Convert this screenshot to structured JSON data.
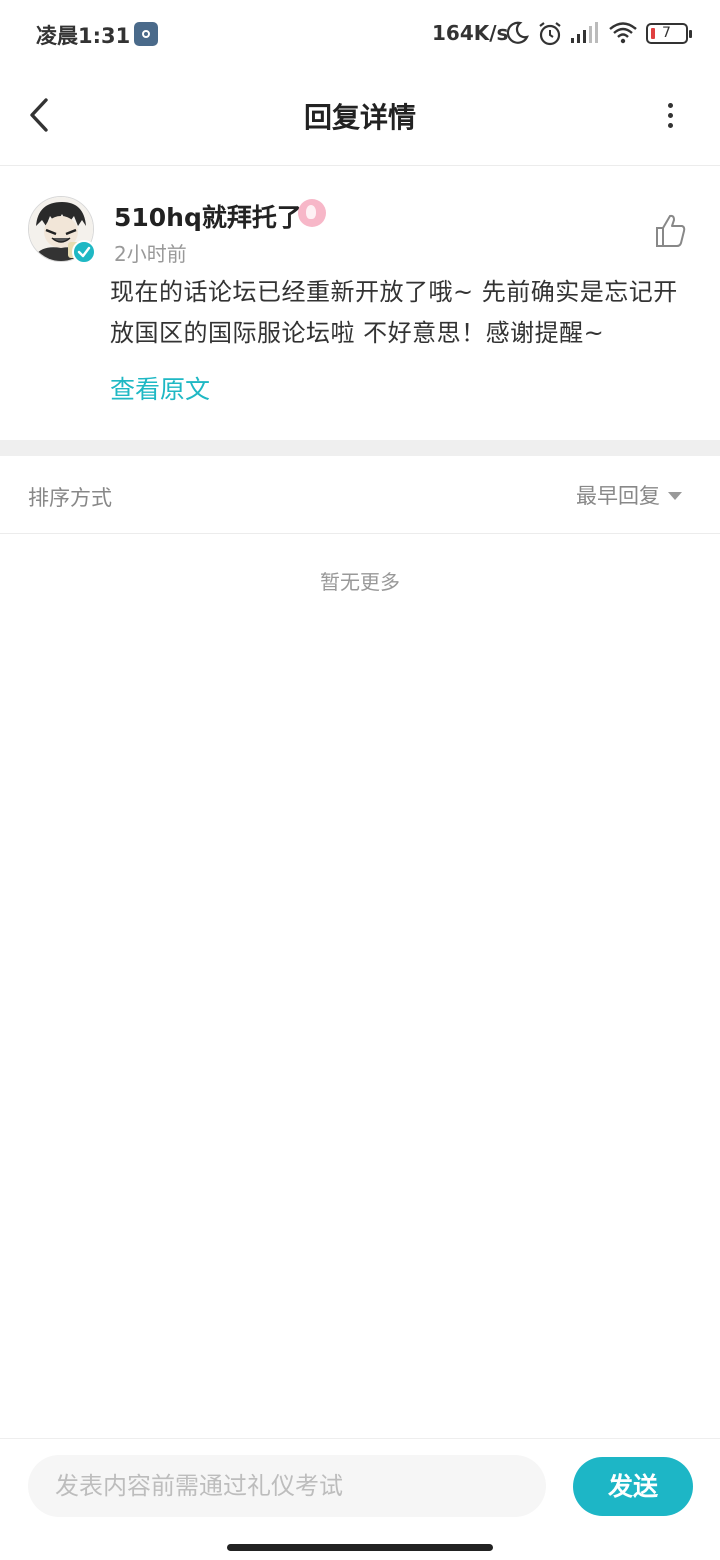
{
  "status_bar": {
    "time": "凌晨1:31",
    "net_speed": "164K/s",
    "battery_level": "7",
    "icons": [
      "settings-icon",
      "moon-icon",
      "alarm-icon",
      "signal-icon",
      "wifi-icon",
      "battery-icon"
    ]
  },
  "header": {
    "title": "回复详情",
    "back_icon": "chevron-left-icon",
    "more_icon": "more-vertical-icon"
  },
  "post": {
    "username": "510hq就拜托了",
    "time": "2小时前",
    "content": "现在的话论坛已经重新开放了哦~ 先前确实是忘记开放国区的国际服论坛啦 不好意思！感谢提醒~",
    "view_original": "查看原文",
    "accent_color": "#1fb8c4"
  },
  "sort": {
    "label": "排序方式",
    "selected": "最早回复"
  },
  "replies": {
    "empty_text": "暂无更多"
  },
  "composer": {
    "placeholder": "发表内容前需通过礼仪考试",
    "value": "",
    "send_label": "发送",
    "send_color": "#1db6c6"
  }
}
